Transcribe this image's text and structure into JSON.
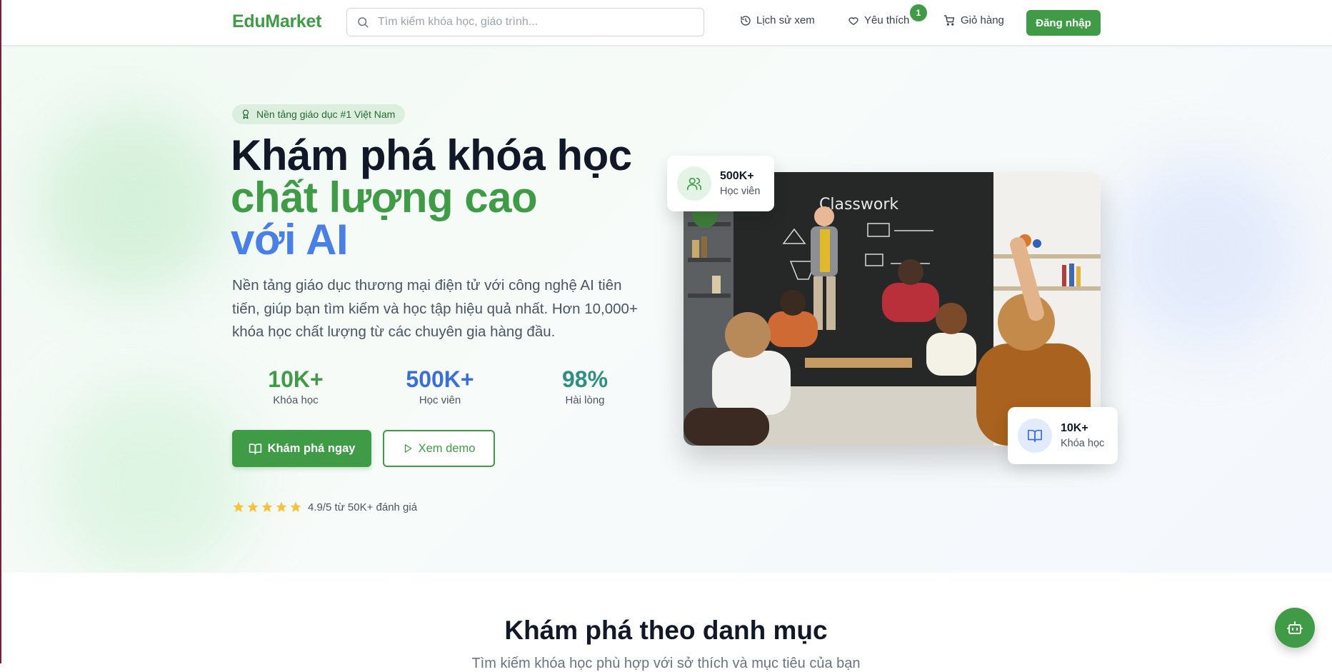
{
  "header": {
    "logo": "EduMarket",
    "search_placeholder": "Tìm kiếm khóa học, giáo trình...",
    "history_label": "Lịch sử xem",
    "favorites_label": "Yêu thích",
    "favorites_count": "1",
    "cart_label": "Giỏ hàng",
    "login_label": "Đăng nhập"
  },
  "hero": {
    "pill": "Nền tảng giáo dục #1 Việt Nam",
    "title_line1": "Khám phá khóa học",
    "title_line2": "chất lượng cao",
    "title_line3": "với AI",
    "description": "Nền tảng giáo dục thương mại điện tử với công nghệ AI tiên tiến, giúp bạn tìm kiếm và học tập hiệu quả nhất. Hơn 10,000+ khóa học chất lượng từ các chuyên gia hàng đầu.",
    "stats": [
      {
        "value": "10K+",
        "label": "Khóa học",
        "color": "#3f9b46"
      },
      {
        "value": "500K+",
        "label": "Học viên",
        "color": "#3b6fd8"
      },
      {
        "value": "98%",
        "label": "Hài lòng",
        "color": "#2f8f83"
      }
    ],
    "primary_button": "Khám phá ngay",
    "secondary_button": "Xem demo",
    "rating_stars": 5,
    "rating_text": "4.9/5 từ 50K+ đánh giá",
    "image_card_top": {
      "value": "500K+",
      "label": "Học viên",
      "icon": "users-icon"
    },
    "image_card_bottom": {
      "value": "10K+",
      "label": "Khóa học",
      "icon": "book-icon"
    },
    "board_text": "Classwork"
  },
  "section": {
    "title": "Khám phá theo danh mục",
    "subtitle": "Tìm kiếm khóa học phù hợp với sở thích và mục tiêu của bạn"
  },
  "colors": {
    "brand_green": "#3f9b46",
    "accent_blue": "#4a7fe6",
    "teal": "#2f8f83",
    "star": "#f6c23e"
  }
}
